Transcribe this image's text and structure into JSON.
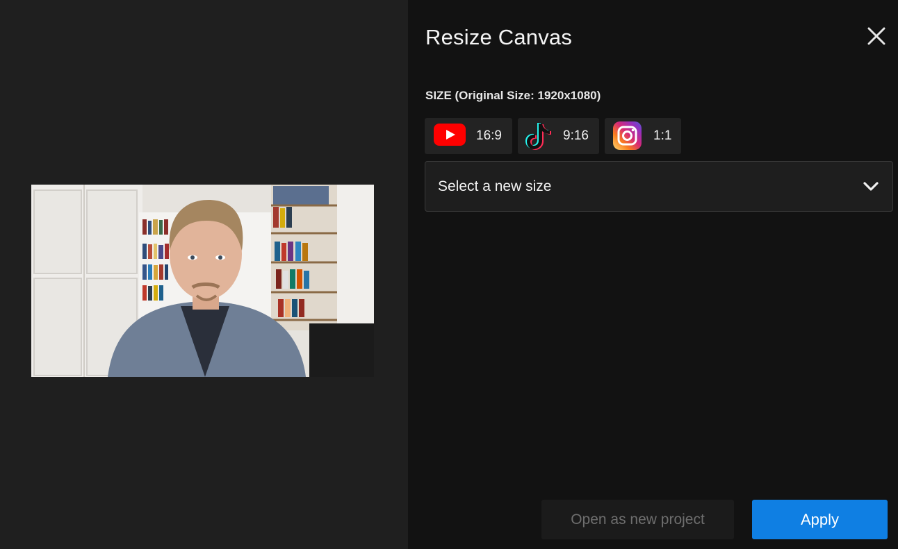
{
  "dialog": {
    "title": "Resize Canvas",
    "size_label": "SIZE (Original Size: 1920x1080)",
    "presets": [
      {
        "icon": "youtube-icon",
        "label": "16:9"
      },
      {
        "icon": "tiktok-icon",
        "label": "9:16"
      },
      {
        "icon": "instagram-icon",
        "label": "1:1"
      }
    ],
    "select": {
      "value": "Select a new size",
      "icon": "chevron-down-icon"
    },
    "buttons": {
      "open_new": "Open as new project",
      "apply": "Apply"
    },
    "close_icon": "close-icon"
  },
  "preview": {
    "description_icon": "video-preview"
  },
  "colors": {
    "accent": "#0f7fe3",
    "panel_bg": "#121212",
    "preview_bg": "#1f1f1f"
  }
}
